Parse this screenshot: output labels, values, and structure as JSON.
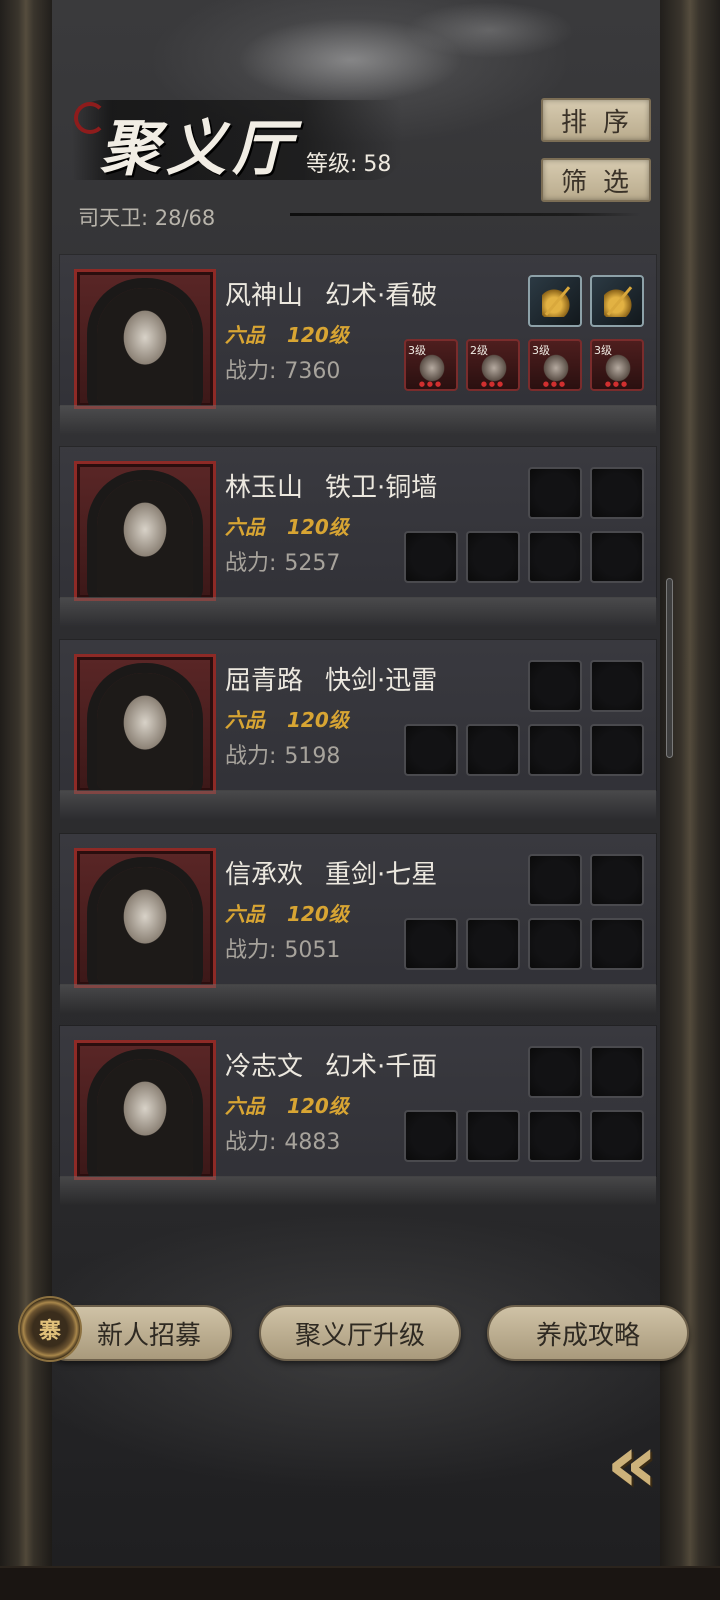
{
  "header": {
    "title": "聚义厅",
    "level_label": "等级:",
    "level_value": "58",
    "guard_text": "司天卫: 28/68",
    "sort_label": "排序",
    "filter_label": "筛选"
  },
  "heroes": [
    {
      "name": "风神山",
      "sect": "幻术·看破",
      "rank": "六品",
      "level": "120级",
      "power_label": "战力:",
      "power": "7360",
      "artifact_slots": [
        "golden-weapon",
        "golden-weapon"
      ],
      "equip_slots": [
        {
          "level": "3级",
          "item": "weapon"
        },
        {
          "level": "2级",
          "item": "armor"
        },
        {
          "level": "3级",
          "item": "helmet"
        },
        {
          "level": "3级",
          "item": "helmet"
        }
      ]
    },
    {
      "name": "林玉山",
      "sect": "铁卫·铜墙",
      "rank": "六品",
      "level": "120级",
      "power_label": "战力:",
      "power": "5257"
    },
    {
      "name": "屈青路",
      "sect": "快剑·迅雷",
      "rank": "六品",
      "level": "120级",
      "power_label": "战力:",
      "power": "5198"
    },
    {
      "name": "信承欢",
      "sect": "重剑·七星",
      "rank": "六品",
      "level": "120级",
      "power_label": "战力:",
      "power": "5051"
    },
    {
      "name": "冷志文",
      "sect": "幻术·千面",
      "rank": "六品",
      "level": "120级",
      "power_label": "战力:",
      "power": "4883"
    }
  ],
  "actions": {
    "recruit_label": "新人招募",
    "recruit_icon_glyph": "寨",
    "upgrade_label": "聚义厅升级",
    "guide_label": "养成攻略",
    "back_glyph": "«"
  },
  "colors": {
    "rank_gold": "#d8a533",
    "portrait_frame_red": "#8e2a26",
    "button_parchment": "#cfc2a6"
  }
}
